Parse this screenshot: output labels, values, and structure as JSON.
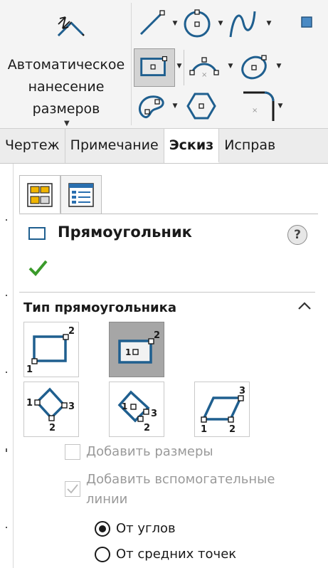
{
  "ribbon": {
    "smart_dimension_label": "Автоматическое\nнанесение\nразмеров",
    "tools": [
      {
        "name": "line-tool",
        "has_dropdown": true
      },
      {
        "name": "circle-tool",
        "has_dropdown": true
      },
      {
        "name": "spline-tool",
        "has_dropdown": true
      },
      {
        "name": "point-tool",
        "has_dropdown": false
      },
      {
        "name": "rectangle-tool",
        "has_dropdown": true,
        "active": true
      },
      {
        "name": "arc-tool",
        "has_dropdown": true
      },
      {
        "name": "ellipse-tool",
        "has_dropdown": true
      },
      {
        "name": "slot-tool",
        "has_dropdown": true
      },
      {
        "name": "polygon-tool",
        "has_dropdown": false
      },
      {
        "name": "fillet-tool",
        "has_dropdown": true
      }
    ]
  },
  "tabs": [
    {
      "label": "Чертеж",
      "active": false
    },
    {
      "label": "Примечание",
      "active": false
    },
    {
      "label": "Эскиз",
      "active": true
    },
    {
      "label": "Исправ",
      "active": false
    }
  ],
  "property_manager": {
    "title": "Прямоугольник",
    "help_label": "?",
    "section_title": "Тип прямоугольника",
    "rect_types": [
      {
        "name": "corner-rectangle",
        "points": [
          "1",
          "2"
        ],
        "selected": false
      },
      {
        "name": "center-rectangle",
        "points": [
          "1",
          "2"
        ],
        "selected": true
      },
      {
        "name": "3-point-corner-rectangle",
        "points": [
          "1",
          "2",
          "3"
        ],
        "selected": false
      },
      {
        "name": "3-point-center-rectangle",
        "points": [
          "1",
          "2",
          "3"
        ],
        "selected": false
      },
      {
        "name": "parallelogram",
        "points": [
          "1",
          "2",
          "3"
        ],
        "selected": false
      }
    ],
    "options": {
      "add_dimensions": {
        "label": "Добавить размеры",
        "checked": false
      },
      "add_construction_lines": {
        "label": "Добавить вспомогательные\nлинии",
        "checked": true
      }
    },
    "radio": {
      "from_corners": {
        "label": "От углов",
        "selected": true
      },
      "from_midpoints": {
        "label": "От средних точек",
        "selected": false
      }
    }
  },
  "colors": {
    "sketch_blue": "#1f5f8f",
    "accept_green": "#3a9a2a",
    "selected_bg": "#a6a6a6"
  }
}
